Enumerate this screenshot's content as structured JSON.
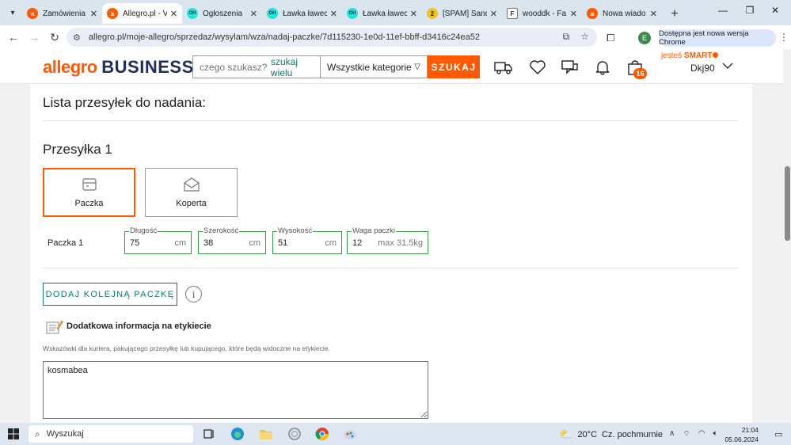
{
  "browser": {
    "tabs": [
      {
        "title": "Zamówienia",
        "favicon": "a",
        "favicon_color": "#ff5a00",
        "active": false
      },
      {
        "title": "Allegro.pl - V",
        "favicon": "a",
        "favicon_color": "#ff5a00",
        "active": true
      },
      {
        "title": "Ogłoszenia",
        "favicon": "OH",
        "favicon_color": "#23e5db",
        "active": false
      },
      {
        "title": "Ławka ławec",
        "favicon": "OH",
        "favicon_color": "#23e5db",
        "active": false
      },
      {
        "title": "Ławka ławec",
        "favicon": "OH",
        "favicon_color": "#23e5db",
        "active": false
      },
      {
        "title": "[SPAM] Sand",
        "favicon": "2",
        "favicon_color": "#f0c419",
        "active": false
      },
      {
        "title": "wooddk - Fa",
        "favicon": "F",
        "favicon_color": "#ffffff",
        "active": false
      },
      {
        "title": "Nowa wiado",
        "favicon": "a",
        "favicon_color": "#ff5a00",
        "active": false
      }
    ],
    "url": "allegro.pl/moje-allegro/sprzedaz/wysylam/wza/nadaj-paczke/7d115230-1e0d-11ef-bbff-d3416c24ea52",
    "profile_initial": "E",
    "update_label": "Dostępna jest nowa wersja Chrome"
  },
  "header": {
    "logo_allegro": "allegro",
    "logo_business": "BUSINESS",
    "search_placeholder": "czego szukasz?",
    "search_many": "szukaj wielu",
    "category": "Wszystkie kategorie",
    "search_button": "SZUKAJ",
    "cart_count": "16",
    "smart_prefix": "jesteś",
    "smart_label": "SMART",
    "username": "Dkj90"
  },
  "page": {
    "title": "Lista przesyłek do nadania:",
    "shipment_title": "Przesyłka 1",
    "types": [
      {
        "label": "Paczka",
        "selected": true
      },
      {
        "label": "Koperta",
        "selected": false
      }
    ],
    "package_label": "Paczka 1",
    "fields": [
      {
        "label": "Długość",
        "value": "75",
        "unit": "cm"
      },
      {
        "label": "Szerokość",
        "value": "38",
        "unit": "cm"
      },
      {
        "label": "Wysokość",
        "value": "51",
        "unit": "cm"
      },
      {
        "label": "Waga paczki",
        "value": "12",
        "unit": "max 31.5kg"
      }
    ],
    "add_button": "DODAJ KOLEJNĄ PACZKĘ",
    "info_glyph": "i",
    "note_title": "Dodatkowa informacja na etykiecie",
    "note_desc": "Wskazówki dla kuriera, pakującego przesyłkę lub kupującego, które będą widoczne na etykiecie.",
    "note_value": "kosmabea"
  },
  "taskbar": {
    "search_placeholder": "Wyszukaj",
    "temperature": "20°C",
    "weather": "Cz. pochmurnie",
    "time": "21:04",
    "date": "05.06.2024"
  }
}
